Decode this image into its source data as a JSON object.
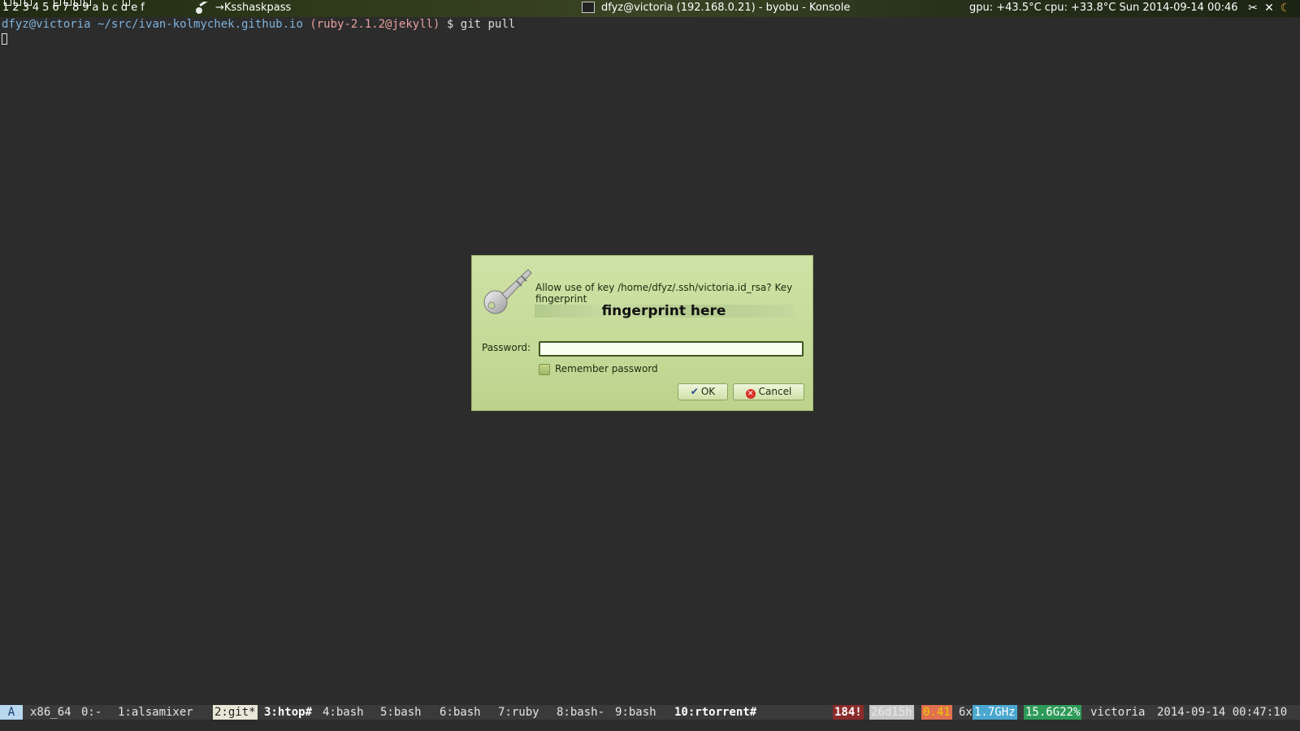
{
  "panel": {
    "desktops": [
      "1",
      "2",
      "3",
      "4",
      "5",
      "6",
      "7",
      "8",
      "9",
      "a",
      "b",
      "c",
      "d",
      "e",
      "f"
    ],
    "active_app": "→Ksshaskpass",
    "window_title": "dfyz@victoria (192.168.0.21) - byobu - Konsole",
    "sensors": "gpu: +43.5°C  cpu: +33.8°C  Sun 2014-09-14 00:46",
    "tray_icons": [
      "network-icon",
      "bluetooth-icon",
      "moon-icon"
    ]
  },
  "terminal": {
    "user": "dfyz@victoria",
    "path": "~/src/ivan-kolmychek.github.io",
    "ruby": "(ruby-2.1.2@jekyll)",
    "command": "$ git pull"
  },
  "dialog": {
    "message": "Allow use of key /home/dfyz/.ssh/victoria.id_rsa? Key fingerprint",
    "fingerprint": "fingerprint here",
    "password_label": "Password:",
    "password_value": "",
    "remember_label": "Remember password",
    "ok_label": "OK",
    "cancel_label": "Cancel"
  },
  "status": {
    "logo": "A",
    "arch": "x86_64",
    "session": "0:-",
    "windows": [
      {
        "label": "1:alsamixer",
        "style": "normal"
      },
      {
        "label": "2:git*",
        "style": "active"
      },
      {
        "label": "3:htop#",
        "style": "bold"
      },
      {
        "label": "4:bash",
        "style": "normal"
      },
      {
        "label": "5:bash",
        "style": "normal"
      },
      {
        "label": "6:bash",
        "style": "normal"
      },
      {
        "label": "7:ruby",
        "style": "normal"
      },
      {
        "label": "8:bash-",
        "style": "normal"
      },
      {
        "label": "9:bash",
        "style": "normal"
      },
      {
        "label": "10:rtorrent#",
        "style": "bold"
      }
    ],
    "updates": "184!",
    "uptime": "26d15h",
    "load": "0.41",
    "cpu_count": "6x",
    "cpu_freq": "1.7GHz",
    "memory": "15.6G22%",
    "host": "victoria",
    "datetime": "2014-09-14 00:47:10"
  }
}
